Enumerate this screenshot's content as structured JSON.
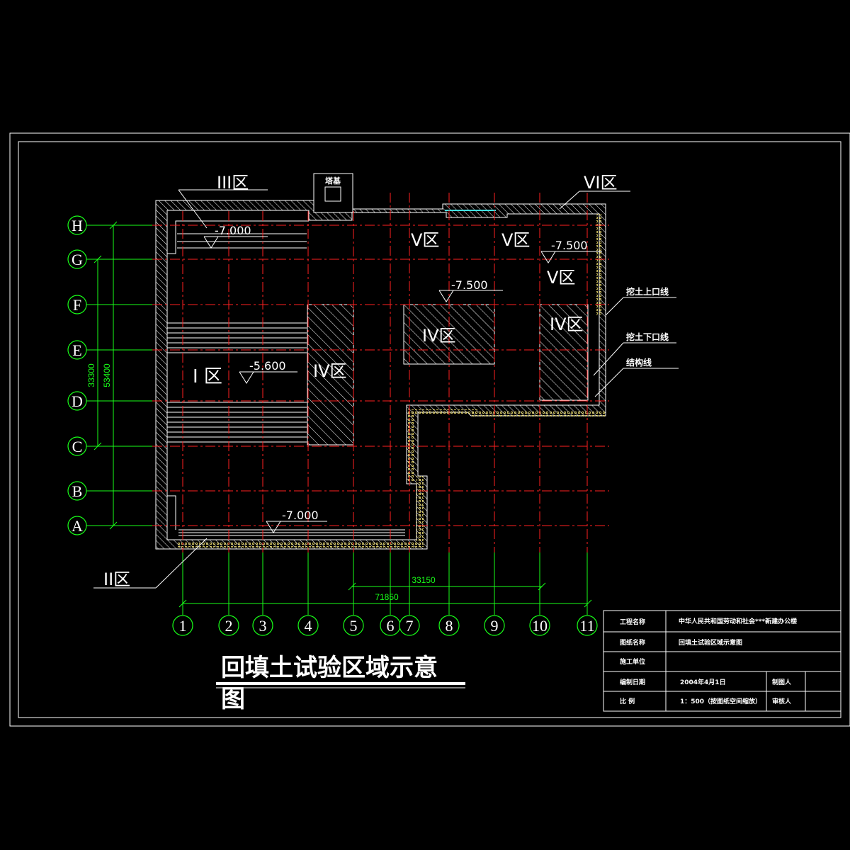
{
  "tower": {
    "label": "塔基"
  },
  "zones": {
    "z3": "III区",
    "z6": "VI区",
    "z1": "I 区",
    "z2": "II区",
    "z4a": "IV区",
    "z4b": "IV区",
    "z4c": "IV区",
    "z5a": "V区",
    "z5b": "V区",
    "z5c": "V区"
  },
  "elevations": {
    "e1": "-7.000",
    "e2": "-7.500",
    "e3": "-7.500",
    "e4": "-5.600",
    "e5": "-7.000"
  },
  "callouts": {
    "dig_top": "挖土上口线",
    "dig_bottom": "挖土下口线",
    "structure": "结构线"
  },
  "dimensions": {
    "vertical_inner": "33300",
    "vertical_outer": "53400",
    "horizontal_inner": "33150",
    "horizontal_outer": "71850"
  },
  "grid": {
    "rows": [
      "H",
      "G",
      "F",
      "E",
      "D",
      "C",
      "B",
      "A"
    ],
    "cols": [
      "1",
      "2",
      "3",
      "4",
      "5",
      "6",
      "7",
      "8",
      "9",
      "10",
      "11"
    ]
  },
  "colors": {
    "background": "#000000",
    "grid_line": "#ff2020",
    "axis_green": "#18ff18",
    "wall": "#ffffff",
    "hatch": "#ffffff",
    "insulation": "#f0e070",
    "cyan_edge": "#40e0e0"
  },
  "title": {
    "line1": "回填土试验区域示意",
    "line2": "图"
  },
  "title_block": {
    "project_label": "工程名称",
    "project_value": "中华人民共和国劳动和社会***新建办公楼",
    "drawing_label": "图纸名称",
    "drawing_value": "回填土试验区域示意图",
    "unit_label": "施工单位",
    "unit_value": "",
    "date_label": "编制日期",
    "date_value": "2004年4月1日",
    "drafter_label": "制图人",
    "scale_label": "比    例",
    "scale_value": "1：500（按图纸空间缩放）",
    "reviewer_label": "审核人"
  }
}
